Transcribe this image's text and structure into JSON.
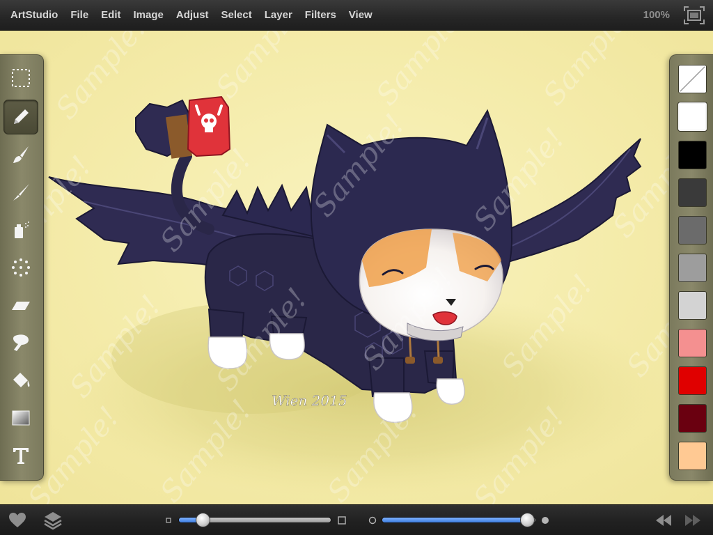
{
  "app": {
    "name": "ArtStudio",
    "menu": [
      "File",
      "Edit",
      "Image",
      "Adjust",
      "Select",
      "Layer",
      "Filters",
      "View"
    ],
    "zoom": "100%"
  },
  "tools": [
    {
      "name": "selection-tool",
      "icon": "marquee-icon"
    },
    {
      "name": "pencil-tool",
      "icon": "pencil-icon",
      "active": true
    },
    {
      "name": "brush-tool",
      "icon": "brush-icon"
    },
    {
      "name": "smudge-tool",
      "icon": "smudge-icon"
    },
    {
      "name": "spray-tool",
      "icon": "spray-can-icon"
    },
    {
      "name": "scatter-tool",
      "icon": "dots-icon"
    },
    {
      "name": "eraser-tool",
      "icon": "eraser-icon"
    },
    {
      "name": "clone-tool",
      "icon": "stamp-icon"
    },
    {
      "name": "fill-tool",
      "icon": "paint-bucket-icon"
    },
    {
      "name": "gradient-tool",
      "icon": "gradient-icon"
    },
    {
      "name": "text-tool",
      "icon": "text-icon"
    }
  ],
  "palette": {
    "swatches": [
      "transparent",
      "#ffffff",
      "#000000",
      "#3a3a3a",
      "#6b6b6b",
      "#9d9d9d",
      "#d3d3d3",
      "#f49090",
      "#e00000",
      "#6a0010",
      "#ffc993"
    ],
    "selected_index": 1
  },
  "canvas": {
    "background": "#f6eeb0",
    "watermark": "Sample!",
    "signature": "Wien 2015"
  },
  "bottom": {
    "brush_size": 0.16,
    "brush_opacity": 0.95
  },
  "colors": {
    "accent": "#3d7de0",
    "suit": "#2a2748"
  }
}
